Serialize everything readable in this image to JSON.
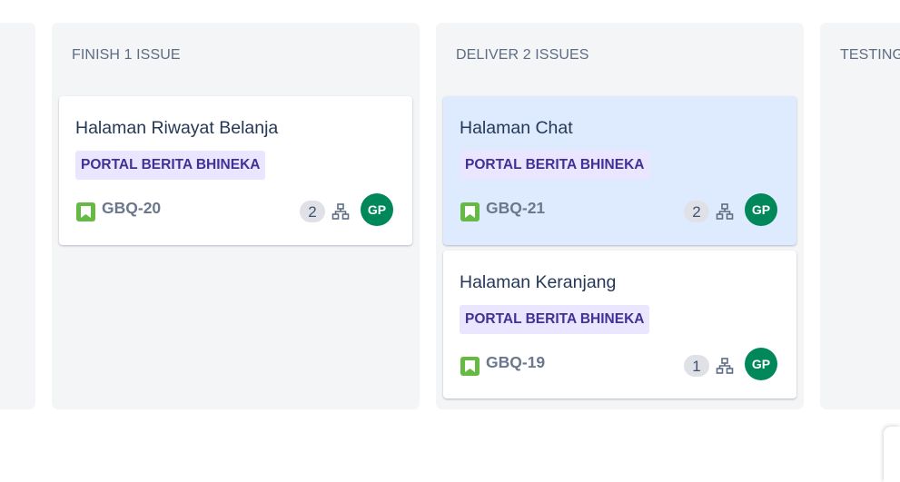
{
  "columns": [
    {
      "title": "FINISH 1 ISSUE"
    },
    {
      "title": "DELIVER 2 ISSUES"
    },
    {
      "title": "TESTING"
    }
  ],
  "cards": [
    {
      "title": "Halaman Riwayat Belanja",
      "label": "PORTAL BERITA BHINEKA",
      "key": "GBQ-20",
      "subtasks": "2",
      "assignee": "GP",
      "type_icon": "story-icon"
    },
    {
      "title": "Halaman Chat",
      "label": "PORTAL BERITA BHINEKA",
      "key": "GBQ-21",
      "subtasks": "2",
      "assignee": "GP",
      "type_icon": "story-icon"
    },
    {
      "title": "Halaman Keranjang",
      "label": "PORTAL BERITA BHINEKA",
      "key": "GBQ-19",
      "subtasks": "1",
      "assignee": "GP",
      "type_icon": "story-icon"
    }
  ],
  "colors": {
    "column_bg": "#f4f5f7",
    "selected_card_bg": "#deebff",
    "label_bg": "#eae6ff",
    "label_text": "#403294",
    "story_green": "#65ba43",
    "avatar_green": "#00875a"
  }
}
